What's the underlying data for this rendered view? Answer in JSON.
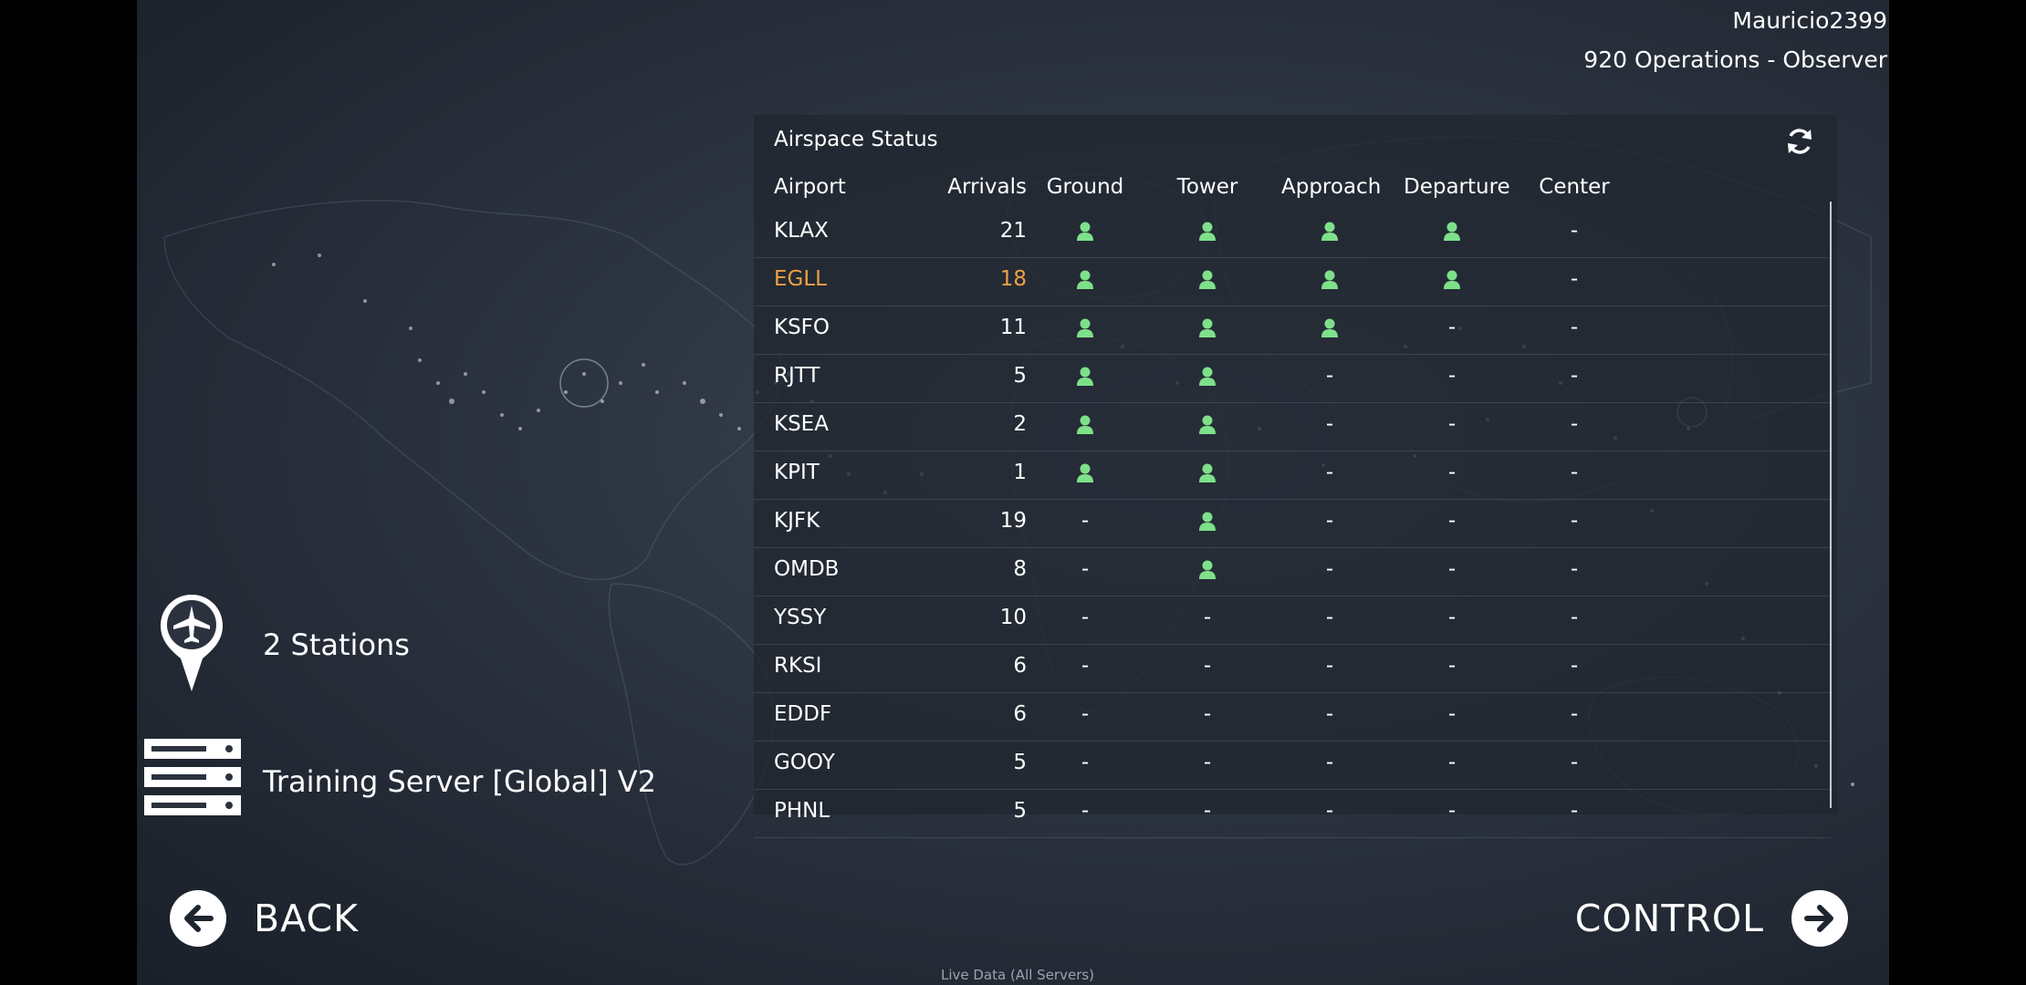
{
  "header": {
    "username": "Mauricio2399",
    "role": "920 Operations - Observer"
  },
  "panel": {
    "title": "Airspace Status",
    "refresh_icon": "refresh-icon",
    "columns": [
      "Airport",
      "Arrivals",
      "Ground",
      "Tower",
      "Approach",
      "Departure",
      "Center"
    ],
    "rows": [
      {
        "airport": "KLAX",
        "arrivals": "21",
        "ground": true,
        "tower": true,
        "approach": true,
        "departure": true,
        "center": false
      },
      {
        "airport": "EGLL",
        "arrivals": "18",
        "ground": true,
        "tower": true,
        "approach": true,
        "departure": true,
        "center": false,
        "highlight": true
      },
      {
        "airport": "KSFO",
        "arrivals": "11",
        "ground": true,
        "tower": true,
        "approach": true,
        "departure": false,
        "center": false
      },
      {
        "airport": "RJTT",
        "arrivals": "5",
        "ground": true,
        "tower": true,
        "approach": false,
        "departure": false,
        "center": false
      },
      {
        "airport": "KSEA",
        "arrivals": "2",
        "ground": true,
        "tower": true,
        "approach": false,
        "departure": false,
        "center": false
      },
      {
        "airport": "KPIT",
        "arrivals": "1",
        "ground": true,
        "tower": true,
        "approach": false,
        "departure": false,
        "center": false
      },
      {
        "airport": "KJFK",
        "arrivals": "19",
        "ground": false,
        "tower": true,
        "approach": false,
        "departure": false,
        "center": false
      },
      {
        "airport": "OMDB",
        "arrivals": "8",
        "ground": false,
        "tower": true,
        "approach": false,
        "departure": false,
        "center": false
      },
      {
        "airport": "YSSY",
        "arrivals": "10",
        "ground": false,
        "tower": false,
        "approach": false,
        "departure": false,
        "center": false
      },
      {
        "airport": "RKSI",
        "arrivals": "6",
        "ground": false,
        "tower": false,
        "approach": false,
        "departure": false,
        "center": false
      },
      {
        "airport": "EDDF",
        "arrivals": "6",
        "ground": false,
        "tower": false,
        "approach": false,
        "departure": false,
        "center": false
      },
      {
        "airport": "GOOY",
        "arrivals": "5",
        "ground": false,
        "tower": false,
        "approach": false,
        "departure": false,
        "center": false
      },
      {
        "airport": "PHNL",
        "arrivals": "5",
        "ground": false,
        "tower": false,
        "approach": false,
        "departure": false,
        "center": false
      }
    ],
    "empty_marker": "-",
    "controller_icon": "person-icon"
  },
  "left": {
    "stations_label": "2 Stations",
    "stations_icon": "airplane-pin-icon",
    "server_label": "Training Server [Global] V2",
    "server_icon": "server-icon"
  },
  "nav": {
    "back_label": "BACK",
    "back_icon": "arrow-left-icon",
    "control_label": "CONTROL",
    "control_icon": "arrow-right-icon"
  },
  "footer": {
    "note": "Live Data (All Servers)"
  },
  "colors": {
    "highlight": "#f0a044",
    "controller_active": "#7ee08a",
    "background": "#2f3744"
  }
}
